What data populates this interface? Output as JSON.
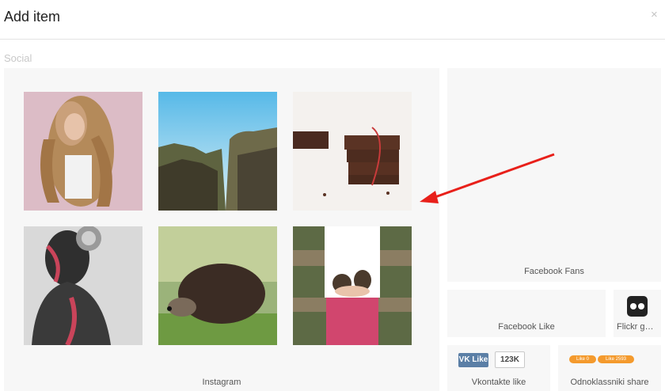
{
  "dialog": {
    "title": "Add item",
    "close_symbol": "×"
  },
  "section": {
    "label": "Social"
  },
  "tiles": {
    "instagram": {
      "label": "Instagram",
      "photos": [
        "curly-haired-woman-photo",
        "mountain-cliffs-photo",
        "chocolate-bars-photo",
        "body-paint-portrait-photo",
        "hedgehog-photo",
        "pinecones-in-hands-photo"
      ]
    },
    "facebook_fans": {
      "label": "Facebook Fans"
    },
    "facebook_like": {
      "label": "Facebook Like"
    },
    "flickr": {
      "label": "Flickr gallery",
      "icon": "flickr-icon"
    },
    "vkontakte": {
      "label": "Vkontakte like",
      "button_text": "VK Like",
      "count": "123K"
    },
    "odnoklassniki": {
      "label": "Odnoklassniki share",
      "buttons": [
        {
          "text": "Like",
          "count": "0"
        },
        {
          "text": "Like",
          "count": "2593"
        }
      ]
    }
  },
  "annotation": {
    "icon": "red-arrow-icon",
    "color": "#e8201a"
  }
}
